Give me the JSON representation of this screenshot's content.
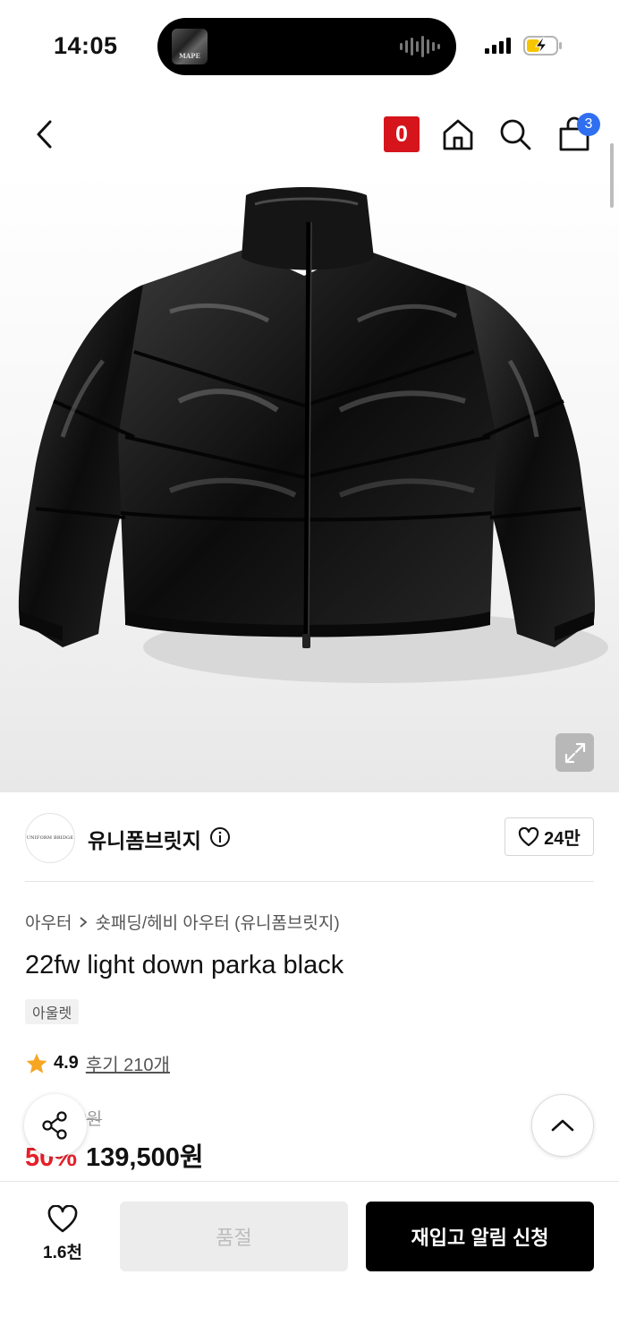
{
  "status_bar": {
    "time": "14:05",
    "now_playing_art_text": "MAPE",
    "battery_state": "charging"
  },
  "nav": {
    "zero_badge": "0",
    "cart_count": "3"
  },
  "product_image": {
    "subject": "black glossy down puffer jacket"
  },
  "brand": {
    "logo_text": "UNIFORM BRIDGE",
    "name": "유니폼브릿지",
    "likes": "24만"
  },
  "breadcrumb": {
    "category": "아우터",
    "subcategory": "숏패딩/헤비 아우터 (유니폼브릿지)"
  },
  "product": {
    "title": "22fw light down parka black",
    "tag": "아울렛",
    "rating": "4.9",
    "reviews": "후기 210개",
    "original_price": "279,000원",
    "discount": "50%",
    "price": "139,500원"
  },
  "bottom_bar": {
    "wish_count": "1.6천",
    "soldout_label": "품절",
    "restock_label": "재입고 알림 신청"
  },
  "colors": {
    "badge_red": "#d6141c",
    "discount_red": "#e5202a",
    "cart_badge_blue": "#2f6ff0",
    "star_orange": "#f5a623"
  }
}
